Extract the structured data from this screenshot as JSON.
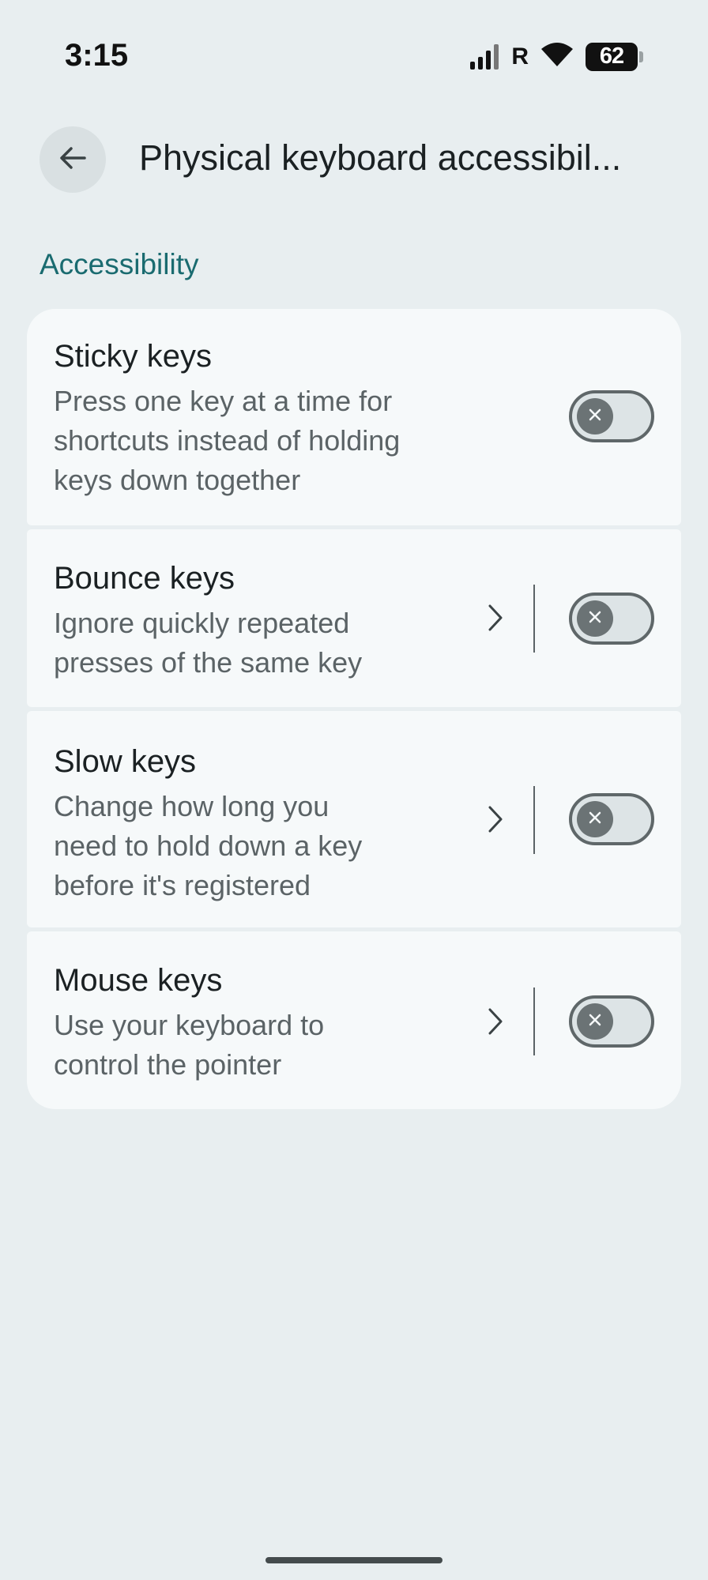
{
  "status_bar": {
    "time": "3:15",
    "roaming": "R",
    "battery": "62"
  },
  "app_bar": {
    "title": "Physical keyboard accessibil..."
  },
  "section": {
    "header": "Accessibility"
  },
  "items": [
    {
      "title": "Sticky keys",
      "description_lines": [
        "Press one key at a time for",
        "shortcuts instead of holding",
        "keys down together"
      ],
      "enabled": false
    },
    {
      "title": "Bounce keys",
      "description_lines": [
        "Ignore quickly repeated",
        "presses of the same key"
      ],
      "enabled": false
    },
    {
      "title": "Slow keys",
      "description_lines": [
        "Change how long you",
        "need to hold down a key",
        "before it's registered"
      ],
      "enabled": false
    },
    {
      "title": "Mouse keys",
      "description_lines": [
        "Use your keyboard to",
        "control the pointer"
      ],
      "enabled": false
    }
  ],
  "colors": {
    "background": "#e8eef0",
    "card": "#f6f9fa",
    "accent": "#1a6b70",
    "toggle_track": "#dde4e6",
    "toggle_thumb": "#6b7375"
  }
}
